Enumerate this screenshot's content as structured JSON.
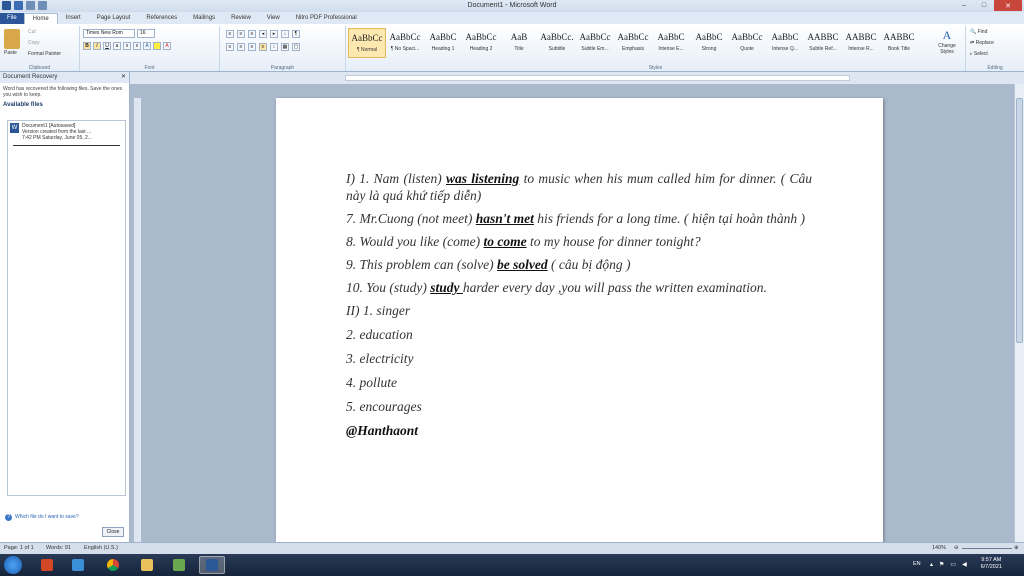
{
  "window": {
    "title": "Document1 - Microsoft Word",
    "controls": [
      "–",
      "□",
      "✕"
    ]
  },
  "tabs": [
    "File",
    "Home",
    "Insert",
    "Page Layout",
    "References",
    "Mailings",
    "Review",
    "View",
    "Nitro PDF Professional"
  ],
  "ribbon": {
    "clipboard": {
      "paste": "Paste",
      "cut": "Cut",
      "copy": "Copy",
      "format_painter": "Format Painter",
      "label": "Clipboard"
    },
    "font": {
      "name": "Times New Rom",
      "size": "16",
      "label": "Font"
    },
    "paragraph": {
      "label": "Paragraph"
    },
    "styles": {
      "label": "Styles",
      "items": [
        {
          "sample": "AaBbCc",
          "name": "¶ Normal"
        },
        {
          "sample": "AaBbCc",
          "name": "¶ No Spaci..."
        },
        {
          "sample": "AaBbC",
          "name": "Heading 1"
        },
        {
          "sample": "AaBbCc",
          "name": "Heading 2"
        },
        {
          "sample": "AaB",
          "name": "Title"
        },
        {
          "sample": "AaBbCc.",
          "name": "Subtitle"
        },
        {
          "sample": "AaBbCc",
          "name": "Subtle Em..."
        },
        {
          "sample": "AaBbCc",
          "name": "Emphasis"
        },
        {
          "sample": "AaBbC",
          "name": "Intense E..."
        },
        {
          "sample": "AaBbC",
          "name": "Strong"
        },
        {
          "sample": "AaBbCc",
          "name": "Quote"
        },
        {
          "sample": "AaBbC",
          "name": "Intense Q..."
        },
        {
          "sample": "AABBC",
          "name": "Subtle Ref..."
        },
        {
          "sample": "AABBC",
          "name": "Intense R..."
        },
        {
          "sample": "AABBC",
          "name": "Book Title"
        }
      ],
      "change_styles": "Change Styles"
    },
    "editing": {
      "find": "Find",
      "replace": "Replace",
      "select": "Select",
      "label": "Editing"
    }
  },
  "recovery": {
    "title": "Document Recovery",
    "message": "Word has recovered the following files. Save the ones you wish to keep.",
    "available": "Available files",
    "file_name": "Document1 [Autosaved]",
    "file_desc": "Version created from the last ...",
    "file_time": "7:42 PM Saturday, June 05, 2...",
    "help": "Which file do I want to save?",
    "close": "Close"
  },
  "document": {
    "lines": [
      {
        "pre": "I) 1.  Nam (listen) ",
        "ans": "was listening",
        "post": "  to music when his mum called him for dinner. (  Câu này là quá khứ tiếp diễn)"
      },
      {
        "pre": "7. Mr.Cuong (not meet) ",
        "ans": "hasn't met",
        "post": " his friends for a long time. ( hiện tại hoàn thành )"
      },
      {
        "pre": "8. Would you like (come) ",
        "ans": "to come",
        "post": " to my house for dinner tonight?"
      },
      {
        "pre": "9.  This problem can (solve) ",
        "ans": "be solved",
        "post": " ( câu bị động )"
      },
      {
        "pre": "10.   You  (study)  ",
        "ans": "study ",
        "post": "harder every day ,you will pass the written examination."
      }
    ],
    "part2": [
      "II) 1. singer",
      "2. education",
      "3. electricity",
      "4. pollute",
      "5. encourages"
    ],
    "signature": "@Hanthaont"
  },
  "status": {
    "page": "Page: 1 of 1",
    "words": "Words: 91",
    "language": "English (U.S.)",
    "zoom": "140%"
  },
  "taskbar": {
    "lang": "EN",
    "time": "9:57 AM",
    "date": "6/7/2021"
  }
}
